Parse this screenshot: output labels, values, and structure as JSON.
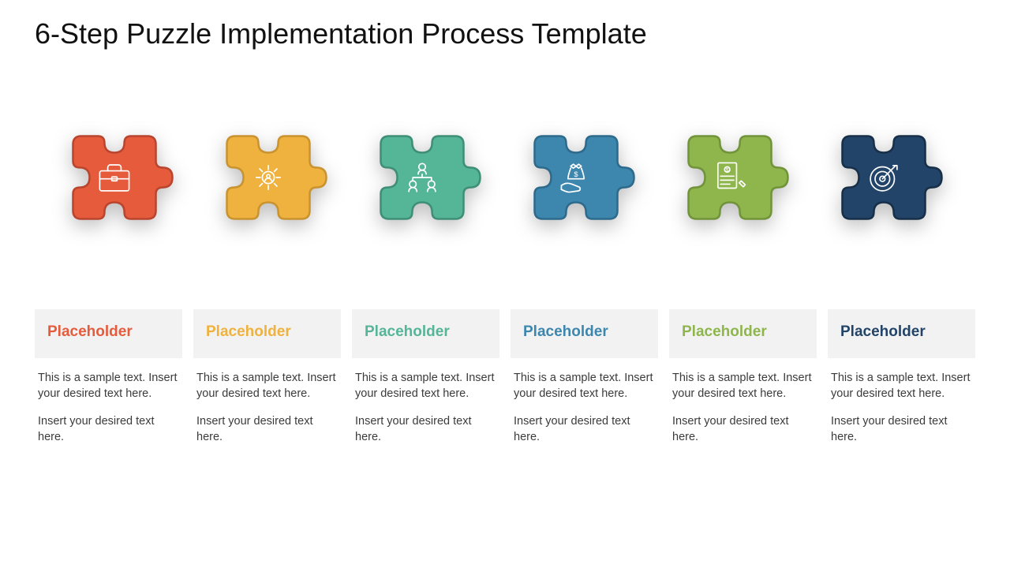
{
  "title": "6-Step Puzzle Implementation Process Template",
  "steps": [
    {
      "fill": "#E55B3C",
      "stroke": "#B9452E",
      "icon": "briefcase-icon",
      "label": "Placeholder",
      "labelColor": "#E55B3C"
    },
    {
      "fill": "#EFB23E",
      "stroke": "#C9932F",
      "icon": "gear-user-icon",
      "label": "Placeholder",
      "labelColor": "#EFB23E"
    },
    {
      "fill": "#55B597",
      "stroke": "#3F8F77",
      "icon": "org-chart-icon",
      "label": "Placeholder",
      "labelColor": "#55B597"
    },
    {
      "fill": "#3D87AF",
      "stroke": "#2D6A8B",
      "icon": "money-hand-icon",
      "label": "Placeholder",
      "labelColor": "#3D87AF"
    },
    {
      "fill": "#8FB64C",
      "stroke": "#71933A",
      "icon": "invoice-icon",
      "label": "Placeholder",
      "labelColor": "#8FB64C"
    },
    {
      "fill": "#234469",
      "stroke": "#172F48",
      "icon": "target-icon",
      "label": "Placeholder",
      "labelColor": "#234469"
    }
  ],
  "body_p1": "This is a sample text. Insert your desired text here.",
  "body_p2": "Insert your desired text here."
}
